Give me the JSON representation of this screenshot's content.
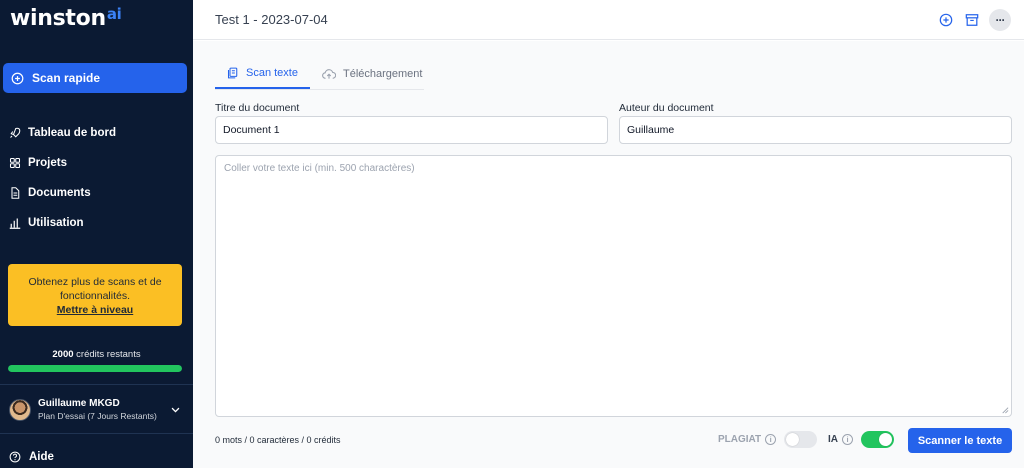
{
  "app": {
    "logo_text": "winston",
    "logo_suffix": "ai"
  },
  "sidebar": {
    "quick_scan_label": "Scan rapide",
    "items": [
      {
        "label": "Tableau de bord",
        "icon": "rocket-icon"
      },
      {
        "label": "Projets",
        "icon": "grid-icon"
      },
      {
        "label": "Documents",
        "icon": "document-icon"
      },
      {
        "label": "Utilisation",
        "icon": "bar-chart-icon"
      }
    ],
    "upgrade": {
      "text": "Obtenez plus de scans et de fonctionnalités.",
      "link": "Mettre à niveau"
    },
    "credits": {
      "amount": "2000",
      "suffix": " crédits restants",
      "fill_percent": 100
    },
    "user": {
      "name": "Guillaume MKGD",
      "plan": "Plan D'essai (7 Jours Restants)"
    },
    "help_label": "Aide"
  },
  "header": {
    "title": "Test 1 - 2023-07-04",
    "more_label": "···"
  },
  "tabs": [
    {
      "label": "Scan texte",
      "active": true,
      "icon": "copy-icon"
    },
    {
      "label": "Téléchargement",
      "active": false,
      "icon": "cloud-upload-icon"
    }
  ],
  "form": {
    "title_label": "Titre du document",
    "title_value": "Document 1",
    "author_label": "Auteur du document",
    "author_value": "Guillaume",
    "text_placeholder": "Coller votre texte ici (min. 500 charactères)"
  },
  "footer": {
    "counts": "0 mots / 0 caractères / 0 crédits",
    "plagiat_label": "PLAGIAT",
    "plagiat_on": false,
    "ia_label": "IA",
    "ia_on": true,
    "info_glyph": "i",
    "scan_button": "Scanner le texte"
  },
  "colors": {
    "sidebar_bg": "#0b1a33",
    "accent": "#2563eb",
    "upgrade_bg": "#fbbf24",
    "success": "#22c55e"
  }
}
